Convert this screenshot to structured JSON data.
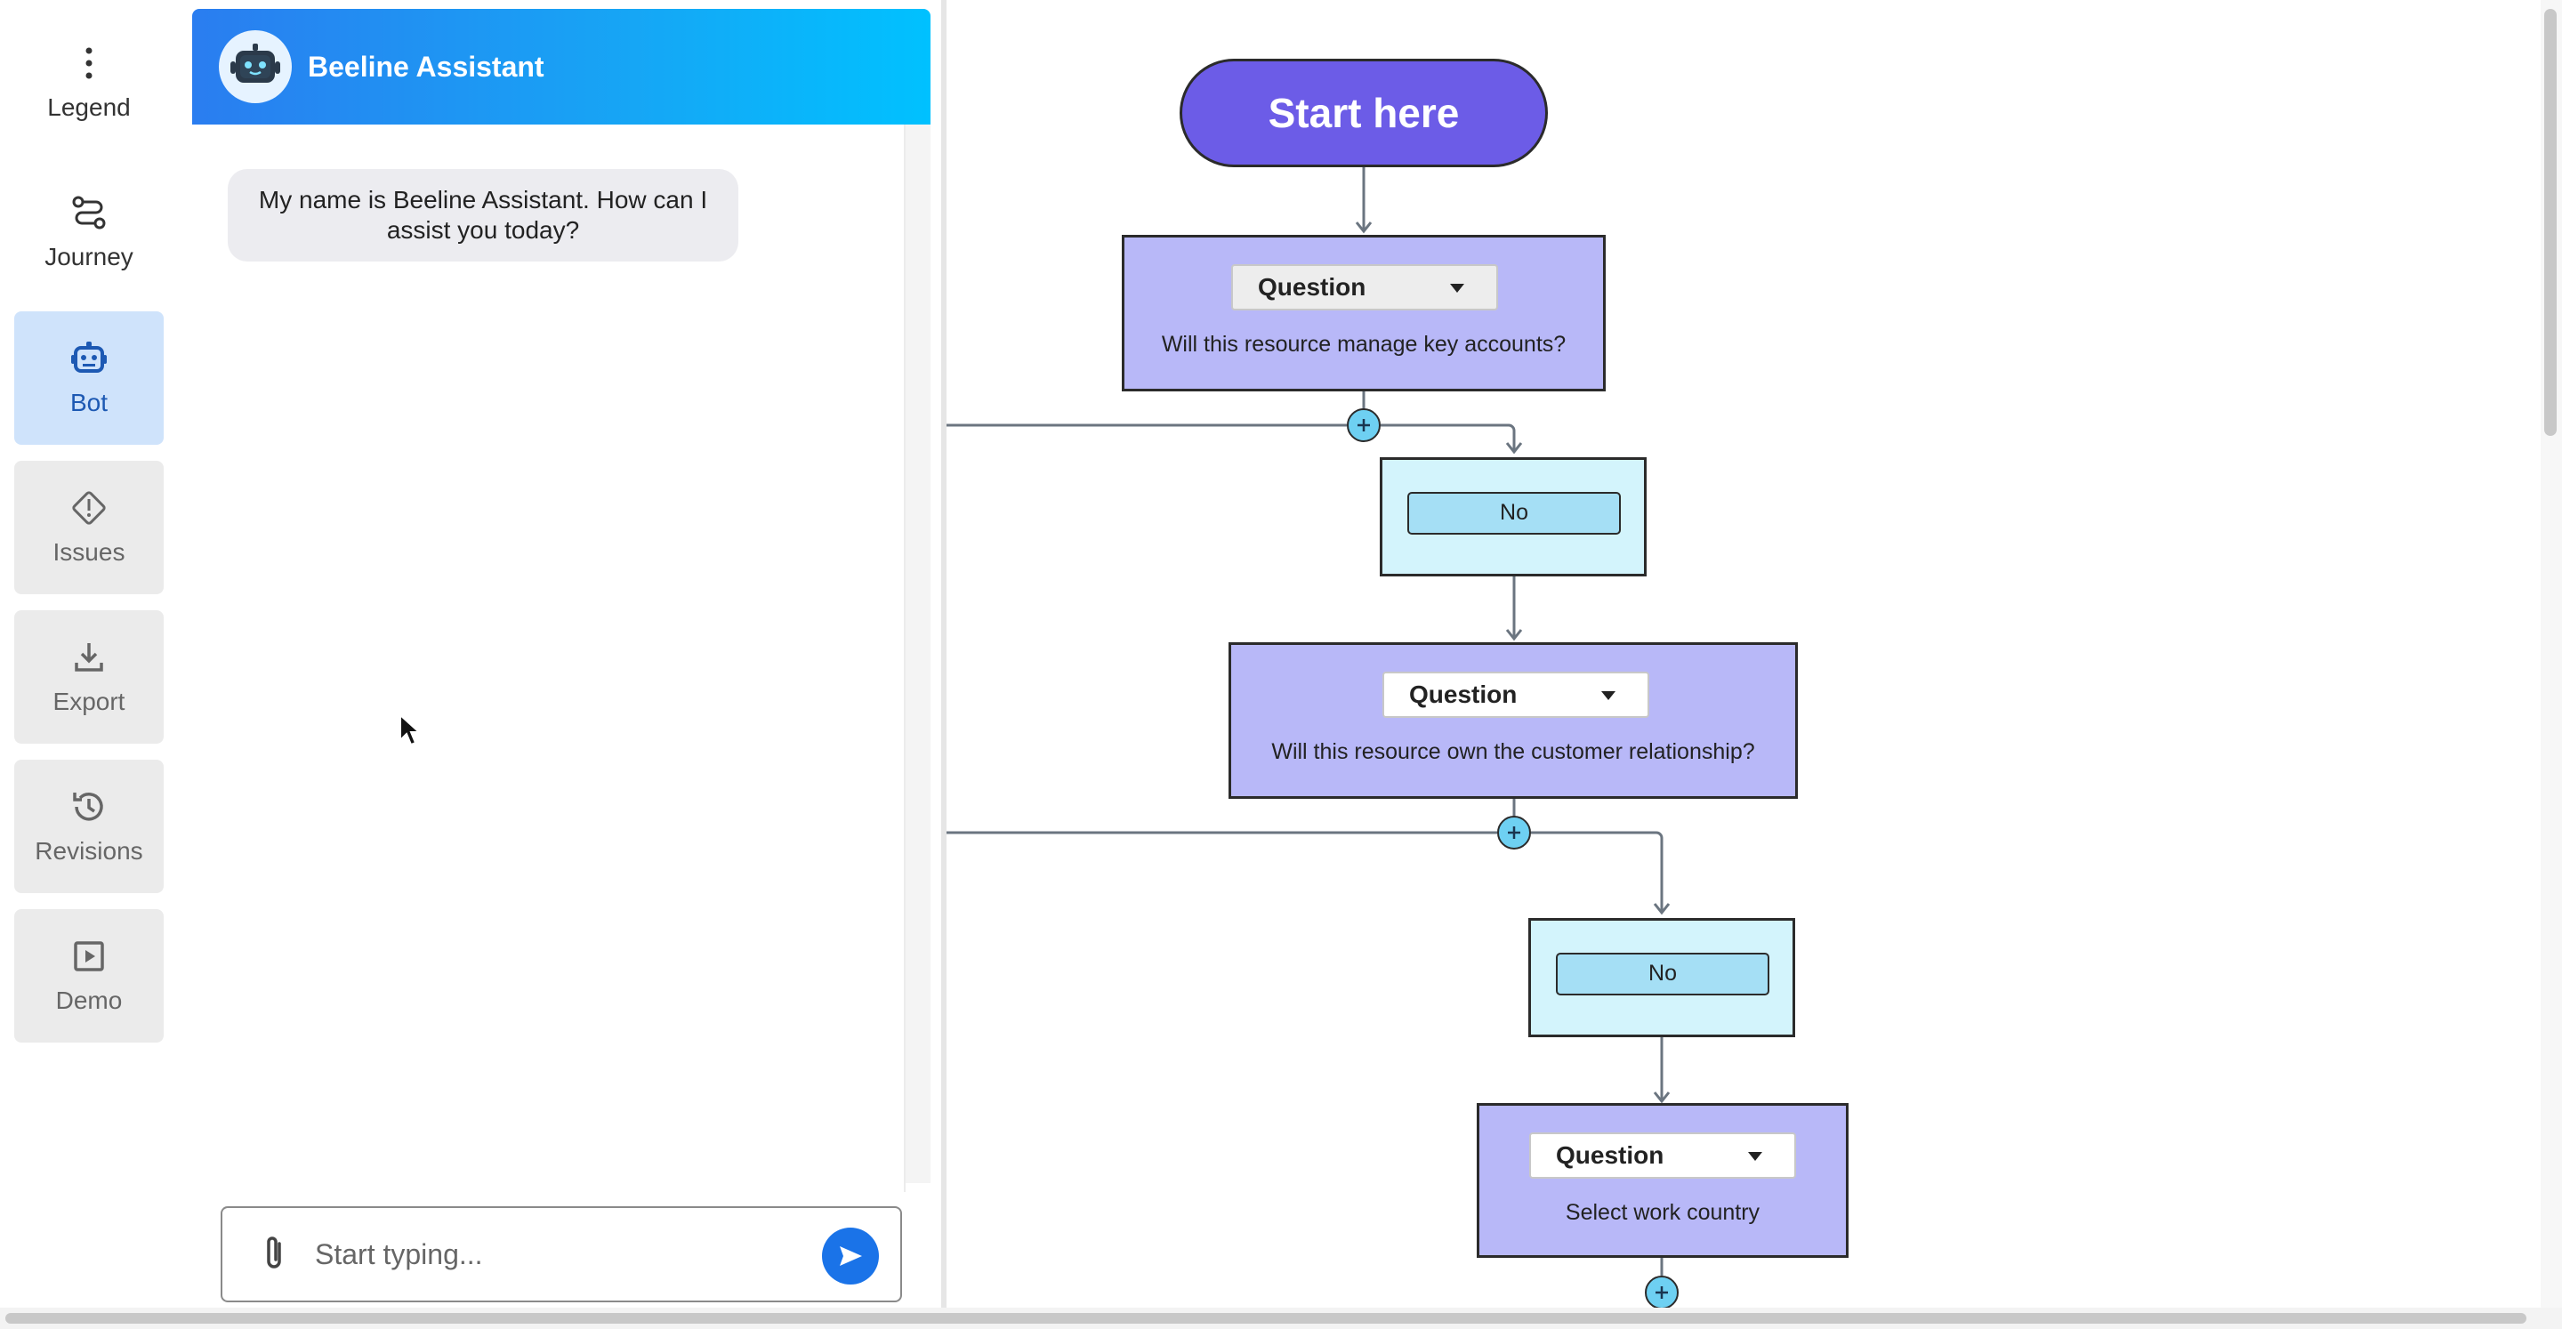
{
  "nav": {
    "legend": "Legend",
    "journey": "Journey",
    "bot": "Bot",
    "issues": "Issues",
    "export": "Export",
    "revisions": "Revisions",
    "demo": "Demo"
  },
  "chat": {
    "title": "Beeline Assistant",
    "messages": [
      {
        "from": "bot",
        "text": "My name is Beeline Assistant. How can I assist you today?"
      }
    ],
    "input_placeholder": "Start typing..."
  },
  "flow": {
    "start_label": "Start here",
    "nodes": [
      {
        "type": "question",
        "select": "Question",
        "text": "Will this resource manage key accounts?"
      },
      {
        "type": "answer",
        "label": "No"
      },
      {
        "type": "question",
        "select": "Question",
        "text": "Will this resource own the customer relationship?"
      },
      {
        "type": "answer",
        "label": "No"
      },
      {
        "type": "question",
        "select": "Question",
        "text": "Select work country"
      }
    ]
  },
  "colors": {
    "start_fill": "#6c5ce7",
    "question_fill": "#b8b8f8",
    "answer_fill": "#d3f4fc",
    "plus_fill": "#6ed0f2",
    "active_nav": "#cfe3fb",
    "header_gradient": [
      "#2a7df0",
      "#00c1ff"
    ]
  }
}
